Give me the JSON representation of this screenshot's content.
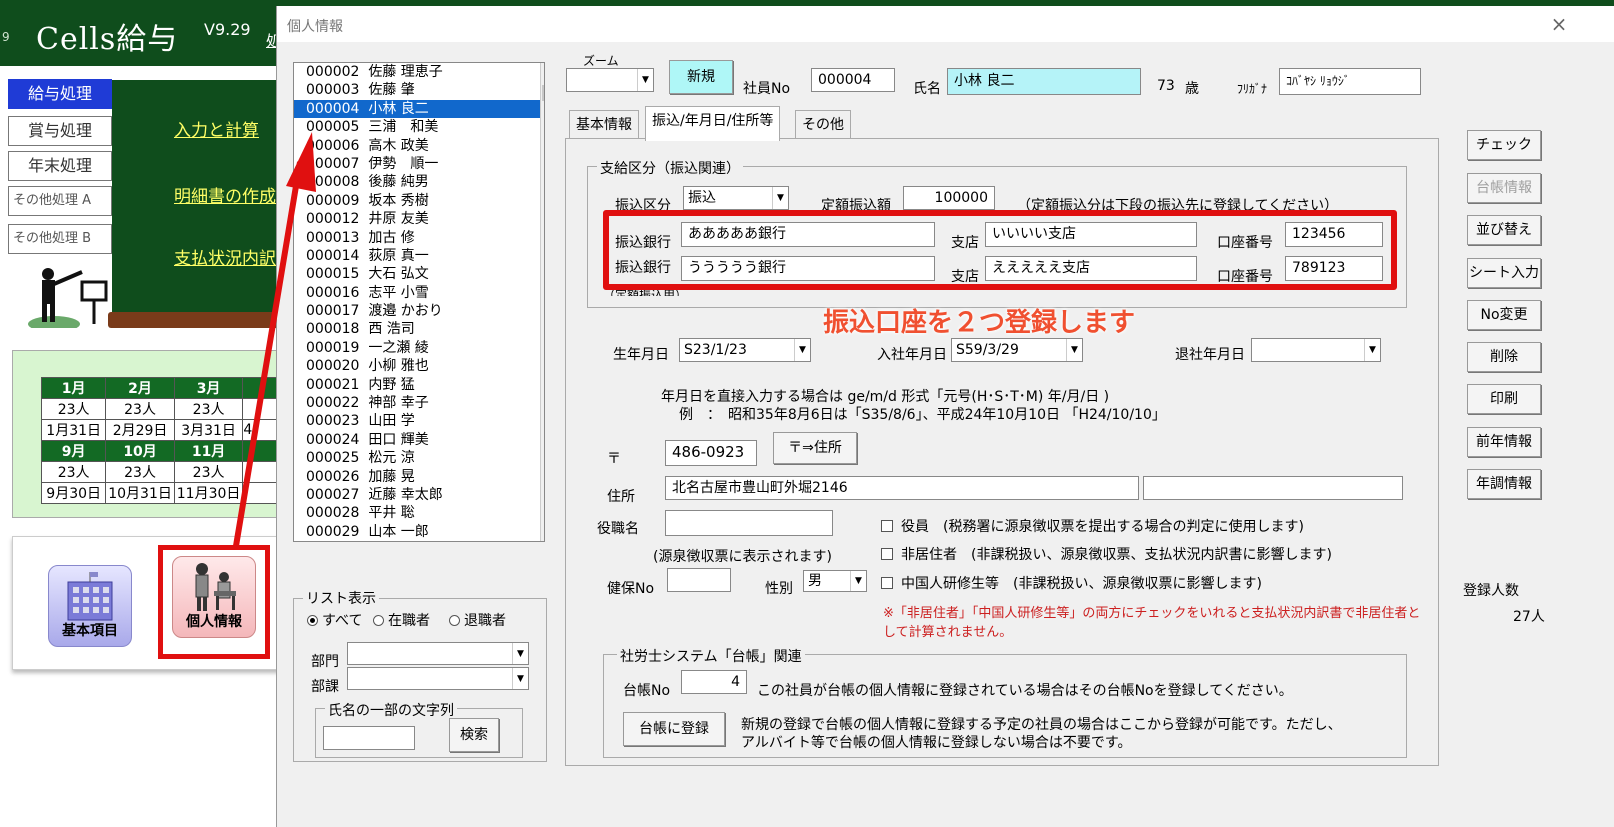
{
  "background_app": {
    "corner_char": "9",
    "title": "Cells給与",
    "version": "V9.29",
    "top_link_fragment": "処",
    "menu": [
      "給与処理",
      "賞与処理",
      "年末処理",
      "その他処理 A",
      "その他処理 B"
    ],
    "links": [
      "入力と計算",
      "明細書の作成",
      "支払状況内訳"
    ],
    "calendar": {
      "row1_months": [
        "1月",
        "2月",
        "3月"
      ],
      "row1_counts": [
        "23人",
        "23人",
        "23人"
      ],
      "row1_dates": [
        "1月31日",
        "2月29日",
        "3月31日"
      ],
      "row2_months": [
        "9月",
        "10月",
        "11月"
      ],
      "row2_counts": [
        "23人",
        "23人",
        "23人"
      ],
      "row2_dates": [
        "9月30日",
        "10月31日",
        "11月30日"
      ],
      "partial_cell": "4"
    },
    "icons": [
      "基本項目",
      "個人情報"
    ]
  },
  "dialog": {
    "title": "個人情報",
    "close": "×",
    "zoom_label": "ズーム",
    "new_button": "新規",
    "emp_no_label": "社員No",
    "emp_no": "000004",
    "name_label": "氏名",
    "name": "小林 良二",
    "age": "73",
    "age_unit": "歳",
    "furigana_label": "ﾌﾘｶﾞﾅ",
    "furigana": "ｺﾊﾞﾔｼ ﾘｮｳｼﾞ",
    "employees": [
      {
        "no": "000002",
        "name": "佐藤 理恵子"
      },
      {
        "no": "000003",
        "name": "佐藤 肇"
      },
      {
        "no": "000004",
        "name": "小林 良二"
      },
      {
        "no": "000005",
        "name": "三浦　和美"
      },
      {
        "no": "000006",
        "name": "高木 政美"
      },
      {
        "no": "000007",
        "name": "伊勢　順一"
      },
      {
        "no": "000008",
        "name": "後藤 純男"
      },
      {
        "no": "000009",
        "name": "坂本 秀樹"
      },
      {
        "no": "000012",
        "name": "井原 友美"
      },
      {
        "no": "000013",
        "name": "加古 修"
      },
      {
        "no": "000014",
        "name": "荻原 真一"
      },
      {
        "no": "000015",
        "name": "大石 弘文"
      },
      {
        "no": "000016",
        "name": "志平 小雪"
      },
      {
        "no": "000017",
        "name": "渡邉 かおり"
      },
      {
        "no": "000018",
        "name": "西 浩司"
      },
      {
        "no": "000019",
        "name": "一之瀬 綾"
      },
      {
        "no": "000020",
        "name": "小柳 雅也"
      },
      {
        "no": "000021",
        "name": "内野 猛"
      },
      {
        "no": "000022",
        "name": "神部 幸子"
      },
      {
        "no": "000023",
        "name": "山田 学"
      },
      {
        "no": "000024",
        "name": "田口 輝美"
      },
      {
        "no": "000025",
        "name": "松元 涼"
      },
      {
        "no": "000026",
        "name": "加藤 晃"
      },
      {
        "no": "000027",
        "name": "近藤 幸太郎"
      },
      {
        "no": "000028",
        "name": "平井 聡"
      },
      {
        "no": "000029",
        "name": "山本 一郎"
      }
    ],
    "selected_employee_index": 2,
    "list_filter": {
      "title": "リスト表示",
      "options": [
        "すべて",
        "在職者",
        "退職者"
      ],
      "selected": "すべて",
      "dept_label": "部門",
      "section_label": "部課",
      "search_group_title": "氏名の一部の文字列",
      "search_button": "検索"
    },
    "tabs": [
      "基本情報",
      "振込/年月日/住所等",
      "その他"
    ],
    "active_tab": "振込/年月日/住所等",
    "payment": {
      "group_title": "支給区分（振込関連）",
      "type_label": "振込区分",
      "type_value": "振込",
      "fixed_label": "定額振込額",
      "fixed_value": "100000",
      "fixed_note": "（定額振込分は下段の振込先に登録してください）",
      "bank_label": "振込銀行",
      "branch_label": "支店",
      "account_label": "口座番号",
      "accounts": [
        {
          "bank": "あああああ銀行",
          "branch": "いいいい支店",
          "account": "123456"
        },
        {
          "bank": "ううううう銀行",
          "branch": "えええええ支店",
          "account": "789123"
        }
      ],
      "partial_note": "（定額振込用）"
    },
    "callout": "振込口座を２つ登録します",
    "dates": {
      "birth_label": "生年月日",
      "birth": "S23/1/23",
      "join_label": "入社年月日",
      "join": "S59/3/29",
      "leave_label": "退社年月日",
      "leave": "",
      "hint1": "年月日を直接入力する場合は ge/m/d  形式「元号(H･S･T･M)  年/月/日 )",
      "hint2": "例　：　昭和35年8月6日は「S35/8/6」、平成24年10月10日 「H24/10/10」"
    },
    "address": {
      "postal_mark": "〒",
      "postal": "486-0923",
      "postal_button": "〒⇒住所",
      "address_label": "住所",
      "address1": "北名古屋市豊山町外堀2146",
      "address2": ""
    },
    "misc": {
      "position_label": "役職名",
      "position": "",
      "position_note": "(源泉徴収票に表示されます)",
      "insurance_label": "健保No",
      "insurance": "",
      "gender_label": "性別",
      "gender": "男",
      "officer_label": "役員　(税務署に源泉徴収票を提出する場合の判定に使用します)",
      "nonresident_label": "非居住者　(非課税扱い、源泉徴収票、支払状況内訳書に影響します)",
      "trainee_label": "中国人研修生等　(非課税扱い、源泉徴収票に影響します)",
      "warning1": "※「非居住者」「中国人研修生等」の両方にチェックをいれると支払状況内訳書で非居住者と",
      "warning2": "して計算されません。"
    },
    "ledger": {
      "group_title": "社労士システム「台帳」関連",
      "no_label": "台帳No",
      "no": "4",
      "no_note": "この社員が台帳の個人情報に登録されている場合はその台帳Noを登録してください。",
      "register_button": "台帳に登録",
      "note1": "新規の登録で台帳の個人情報に登録する予定の社員の場合はここから登録が可能です。ただし、",
      "note2": "アルバイト等で台帳の個人情報に登録しない場合は不要です。"
    },
    "side_buttons": [
      "チェック",
      "台帳情報",
      "並び替え",
      "シート入力",
      "No変更",
      "削除",
      "印刷",
      "前年情報",
      "年調情報"
    ],
    "count_label": "登録人数",
    "count": "27人",
    "colors": {
      "accent_red": "#e01010",
      "selection_blue": "#1168cc",
      "name_field": "#b5f3f8",
      "header_green": "#0f4d1c"
    }
  }
}
